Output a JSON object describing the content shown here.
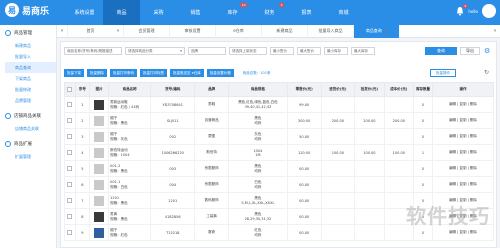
{
  "app": {
    "logo_text": "易商乐",
    "logo_mark": "易"
  },
  "nav": [
    {
      "label": "系统设置",
      "badge": ""
    },
    {
      "label": "商品",
      "badge": ""
    },
    {
      "label": "采购",
      "badge": ""
    },
    {
      "label": "销售",
      "badge": ""
    },
    {
      "label": "库存",
      "badge": "10"
    },
    {
      "label": "财务",
      "badge": "5"
    },
    {
      "label": "报表",
      "badge": ""
    },
    {
      "label": "商城",
      "badge": ""
    }
  ],
  "top_right": {
    "bell_badge": "9",
    "user": "hello"
  },
  "sidebar": {
    "groups": [
      {
        "title": "商品管理",
        "items": [
          "新建商品",
          "批量导入",
          "商品查询",
          "下架商品",
          "批量修改",
          "品牌管理"
        ],
        "active": 2
      },
      {
        "title": "店铺商品关联",
        "items": [
          "店铺商品关联"
        ],
        "active": -1
      },
      {
        "title": "商品扩展",
        "items": [
          "扩展管理"
        ],
        "active": -1
      }
    ]
  },
  "tabs": [
    {
      "label": "首页",
      "active": false
    },
    {
      "label": "会员管理",
      "active": false
    },
    {
      "label": "审核设置",
      "active": false
    },
    {
      "label": "e仓库",
      "active": false
    },
    {
      "label": "新建商品",
      "active": false
    },
    {
      "label": "批量导入商品",
      "active": false
    },
    {
      "label": "商品查询",
      "active": true
    }
  ],
  "filters": {
    "keyword_placeholder": "商品名称/货号/条码/规格描述",
    "category": "请选择商品分类",
    "brand": "品牌",
    "status": "请选择上架状态",
    "min_price": "最小售价",
    "max_price": "最大售价",
    "min_stock": "最小库存",
    "max_stock": "最大库存"
  },
  "buttons": {
    "search": "查询",
    "export": "导出",
    "batch": "批量操作"
  },
  "actions": [
    "批量下架",
    "批量删除",
    "批量打印条码",
    "批量打印标签",
    "批量推送至 e仓库",
    "批量设置价格"
  ],
  "selected_count_text": "商品总数：101条",
  "table": {
    "headers": [
      "",
      "序号",
      "图片",
      "商品名称",
      "货号/编码",
      "品牌",
      "商品规格",
      "零售价(元)",
      "进货价(元)",
      "批发价(元)",
      "成本价(元)",
      "库存数量",
      "操作"
    ],
    "rows": [
      {
        "no": "1",
        "thumb": "dark",
        "name": "男款运动鞋\n规格：红色 / 41码",
        "code": "YD3708641",
        "brand": "男鞋",
        "spec": "黑色,红色,绿色,蓝色,白色\n39,40,41,42,43",
        "retail": "99.00",
        "purchase": "",
        "wholesale": "",
        "cost": "",
        "stock": "0",
        "ops": "编辑 | 复制 | 删除"
      },
      {
        "no": "2",
        "thumb": "light",
        "name": "帽子\n规格：黑色",
        "code": "SLJ011",
        "brand": "自营精品",
        "spec": "黑色\n均码",
        "retail": "300.00",
        "purchase": "200.00",
        "wholesale": "200.00",
        "cost": "200.00",
        "stock": "0",
        "ops": "编辑 | 复制 | 删除"
      },
      {
        "no": "3",
        "thumb": "light",
        "name": "帽子\n规格：灰色",
        "code": "002",
        "brand": "蒙图",
        "spec": "灰色\n均码",
        "retail": "50.00",
        "purchase": "",
        "wholesale": "",
        "cost": "",
        "stock": "0",
        "ops": "编辑 | 复制 | 删除"
      },
      {
        "no": "4",
        "thumb": "light",
        "name": "斯伯特运动\n规格：1004",
        "code": "1006266220",
        "brand": "斯伯特",
        "spec": "1004\n1M",
        "retail": "120.00",
        "purchase": "100.00",
        "wholesale": "100.00",
        "cost": "100.00",
        "stock": "1",
        "ops": "编辑 | 复制 | 删除"
      },
      {
        "no": "5",
        "thumb": "light",
        "name": "001-2\n规格：黑色",
        "code": "003",
        "brand": "有限服饰",
        "spec": "黑色\n均码",
        "retail": "00.00",
        "purchase": "",
        "wholesale": "",
        "cost": "",
        "stock": "0",
        "ops": "编辑 | 复制 | 删除"
      },
      {
        "no": "6",
        "thumb": "light",
        "name": "001-1\n规格：白色",
        "code": "004",
        "brand": "有限服饰",
        "spec": "白色\n均码",
        "retail": "00.00",
        "purchase": "",
        "wholesale": "",
        "cost": "",
        "stock": "0",
        "ops": "编辑 | 复制 | 删除"
      },
      {
        "no": "7",
        "thumb": "light",
        "name": "1201\n规格：黑色",
        "code": "1201",
        "brand": "数码服饰",
        "spec": "黑色\nS,M,L,XL,XXL,XXXL",
        "retail": "00.00",
        "purchase": "",
        "wholesale": "",
        "cost": "",
        "stock": "0",
        "ops": "编辑 | 复制 | 删除"
      },
      {
        "no": "8",
        "thumb": "dark",
        "name": "男裤\n规格：黑色",
        "code": "4182856",
        "brand": "工装裤",
        "spec": "黑色\n28,29,30,31,32",
        "retail": "00.00",
        "purchase": "",
        "wholesale": "",
        "cost": "",
        "stock": "0",
        "ops": "编辑 | 复制 | 删除"
      },
      {
        "no": "9",
        "thumb": "blue",
        "name": "帽子\n规格：红色",
        "code": "T15218",
        "brand": "赛奇",
        "spec": "红色\n均码",
        "retail": "00.00",
        "purchase": "",
        "wholesale": "",
        "cost": "",
        "stock": "0",
        "ops": "编辑 | 复制 | 删除"
      }
    ]
  },
  "watermark": "软件技巧",
  "colors": {
    "primary": "#2b8ee6",
    "danger": "#f04b4b"
  }
}
